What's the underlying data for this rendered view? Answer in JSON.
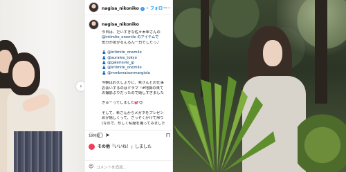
{
  "left_photo": {
    "next_arrow": "›"
  },
  "post": {
    "header": {
      "username": "nagisa_nikoniko",
      "verified_badge": "✓",
      "separator": "•",
      "follow_label": "フォロー",
      "more_icon": "…"
    },
    "caption_author": "nagisa_nikoniko",
    "caption_lines": [
      {
        "text": "今日は、だいすきな佐々木希さんの",
        "link": false
      },
      {
        "text": "@intimite_onemile のアイテムで",
        "link": true
      },
      {
        "text": "気分があがるんるん一日でしたっ♪",
        "link": false
      },
      {
        "text": "",
        "link": false
      },
      {
        "text": "👗 @intimite_onemile",
        "link": true
      },
      {
        "text": "👗 @auralee_tokyo",
        "link": true
      },
      {
        "text": "👗 @galerievie_jp",
        "link": true
      },
      {
        "text": "👗 @intimite_onemile",
        "link": true
      },
      {
        "text": "👗 @mmbmaisonmargiela",
        "link": true
      },
      {
        "text": "",
        "link": false
      },
      {
        "text": "今朝はお久しぶりに、希さんとお仕事",
        "link": false
      },
      {
        "text": "お会いするのはドラマ『#地獄の果て",
        "link": false
      },
      {
        "text": "の撮影ぶりだったので嬉しすぎました",
        "link": false
      },
      {
        "text": "",
        "link": false
      },
      {
        "text": "ぎゅーってしました💕😍",
        "link": false
      },
      {
        "text": "",
        "link": false
      },
      {
        "text": "そして、希さんからメガネをプレゼン",
        "link": false
      },
      {
        "text": "めが嬉しくって、さっそくかけて帰り",
        "link": false
      },
      {
        "text": "(なので、珍しく私服を撮ってみました",
        "link": false
      }
    ],
    "actions": {
      "like_icon": "♡",
      "comment_icon": "◯",
      "share_icon": "➤",
      "save_icon": "⊓"
    },
    "likes_count_label": "19時間",
    "likes_text_prefix": "その他",
    "likes_text_suffix": "「いいね！」しました",
    "comment": {
      "emoji_icon": "☺",
      "placeholder": "コメントを追加..."
    }
  }
}
